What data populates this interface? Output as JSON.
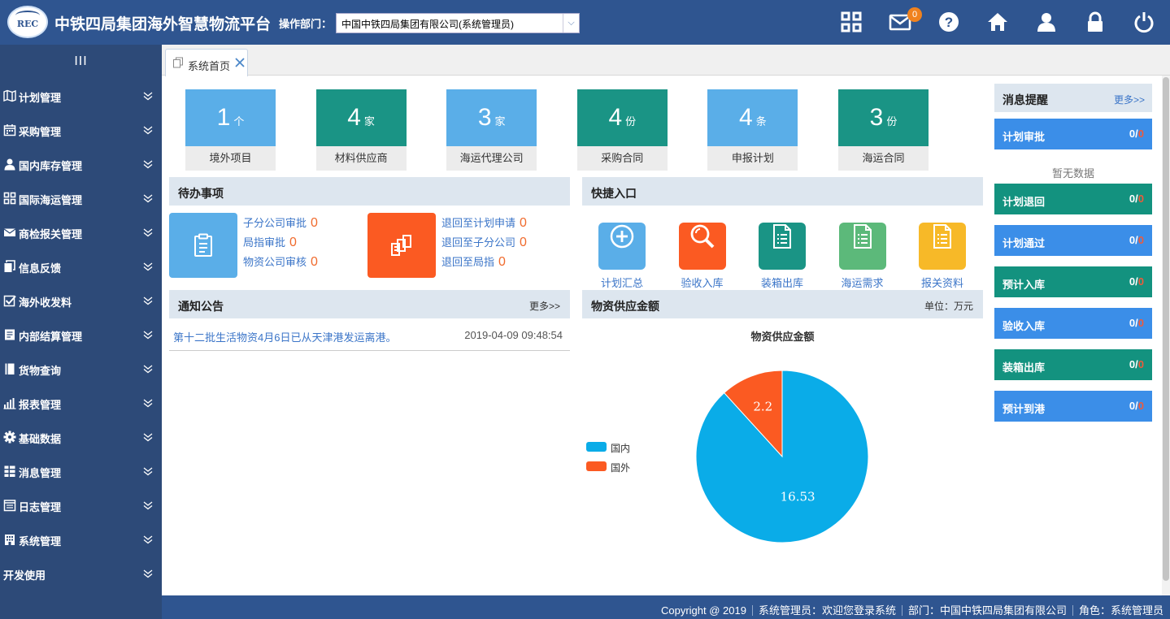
{
  "header": {
    "logo_text": "REC",
    "title": "中铁四局集团海外智慧物流平台",
    "dept_label": "操作部门：",
    "dept_value": "中国中铁四局集团有限公司(系统管理员)",
    "mail_badge": "0",
    "icons": [
      "grid-icon",
      "mail-icon",
      "help-icon",
      "home-icon",
      "user-icon",
      "lock-icon",
      "power-icon"
    ]
  },
  "sidebar": {
    "toggle_glyph": "III",
    "items": [
      {
        "label": "计划管理",
        "icon": "map-icon"
      },
      {
        "label": "采购管理",
        "icon": "calendar-icon"
      },
      {
        "label": "国内库存管理",
        "icon": "user-icon"
      },
      {
        "label": "国际海运管理",
        "icon": "grid-icon"
      },
      {
        "label": "商检报关管理",
        "icon": "envelope-icon"
      },
      {
        "label": "信息反馈",
        "icon": "copy-icon"
      },
      {
        "label": "海外收发料",
        "icon": "checkbox-icon"
      },
      {
        "label": "内部结算管理",
        "icon": "doc-icon"
      },
      {
        "label": "货物查询",
        "icon": "book-icon"
      },
      {
        "label": "报表管理",
        "icon": "bar-chart-icon"
      },
      {
        "label": "基础数据",
        "icon": "gear-icon"
      },
      {
        "label": "消息管理",
        "icon": "list-icon"
      },
      {
        "label": "日志管理",
        "icon": "log-icon"
      },
      {
        "label": "系统管理",
        "icon": "building-icon"
      },
      {
        "label": "开发使用",
        "icon": ""
      }
    ]
  },
  "tabs": [
    {
      "label": "系统首页"
    }
  ],
  "stats": [
    {
      "value": "1",
      "unit": "个",
      "label": "境外项目",
      "color": "#5aaee8"
    },
    {
      "value": "4",
      "unit": "家",
      "label": "材料供应商",
      "color": "#1a9485"
    },
    {
      "value": "3",
      "unit": "家",
      "label": "海运代理公司",
      "color": "#5aaee8"
    },
    {
      "value": "4",
      "unit": "份",
      "label": "采购合同",
      "color": "#1a9485"
    },
    {
      "value": "4",
      "unit": "条",
      "label": "申报计划",
      "color": "#5aaee8"
    },
    {
      "value": "3",
      "unit": "份",
      "label": "海运合同",
      "color": "#1a9485"
    }
  ],
  "todo": {
    "title": "待办事项",
    "groups": [
      {
        "color": "#5aaee8",
        "icon": "clipboard-icon",
        "items": [
          {
            "label": "子分公司审批",
            "count": "0"
          },
          {
            "label": "局指审批",
            "count": "0"
          },
          {
            "label": "物资公司审核",
            "count": "0"
          }
        ]
      },
      {
        "color": "#fb5a22",
        "icon": "return-icon",
        "items": [
          {
            "label": "退回至计划申请",
            "count": "0"
          },
          {
            "label": "退回至子分公司",
            "count": "0"
          },
          {
            "label": "退回至局指",
            "count": "0"
          }
        ]
      }
    ]
  },
  "quick": {
    "title": "快捷入口",
    "items": [
      {
        "label": "计划汇总",
        "color": "#5aaee8",
        "icon": "plus-circle-icon"
      },
      {
        "label": "验收入库",
        "color": "#fb5a22",
        "icon": "magnifier-icon"
      },
      {
        "label": "装箱出库",
        "color": "#1a9485",
        "icon": "document-icon"
      },
      {
        "label": "海运需求",
        "color": "#5cb97a",
        "icon": "document-icon"
      },
      {
        "label": "报关资料",
        "color": "#f7b928",
        "icon": "document-icon"
      }
    ]
  },
  "notice": {
    "title": "通知公告",
    "more": "更多>>",
    "items": [
      {
        "title": "第十二批生活物资4月6日已从天津港发运离港。",
        "time": "2019-04-09 09:48:54"
      }
    ]
  },
  "supply": {
    "title": "物资供应金额",
    "unit": "单位：万元"
  },
  "chart_data": {
    "type": "pie",
    "title": "物资供应金额",
    "categories": [
      "国内",
      "国外"
    ],
    "values": [
      16.53,
      2.2
    ],
    "colors": [
      "#0aace8",
      "#fb5a22"
    ],
    "legend_position": "left"
  },
  "messages": {
    "title": "消息提醒",
    "more": "更多>>",
    "empty_text": "暂无数据",
    "items": [
      {
        "label": "计划审批",
        "total": "0/",
        "unread": "0",
        "color": "#3b8ee8"
      },
      {
        "label": "计划退回",
        "total": "0/",
        "unread": "0",
        "color": "#13927f"
      },
      {
        "label": "计划通过",
        "total": "0/",
        "unread": "0",
        "color": "#3b8ee8"
      },
      {
        "label": "预计入库",
        "total": "0/",
        "unread": "0",
        "color": "#13927f"
      },
      {
        "label": "验收入库",
        "total": "0/",
        "unread": "0",
        "color": "#3b8ee8"
      },
      {
        "label": "装箱出库",
        "total": "0/",
        "unread": "0",
        "color": "#13927f"
      },
      {
        "label": "预计到港",
        "total": "0/",
        "unread": "0",
        "color": "#3b8ee8"
      }
    ]
  },
  "footer": {
    "copyright": "Copyright @ 2019",
    "user": "系统管理员：欢迎您登录系统",
    "dept": "部门：中国中铁四局集团有限公司",
    "role": "角色：系统管理员"
  }
}
